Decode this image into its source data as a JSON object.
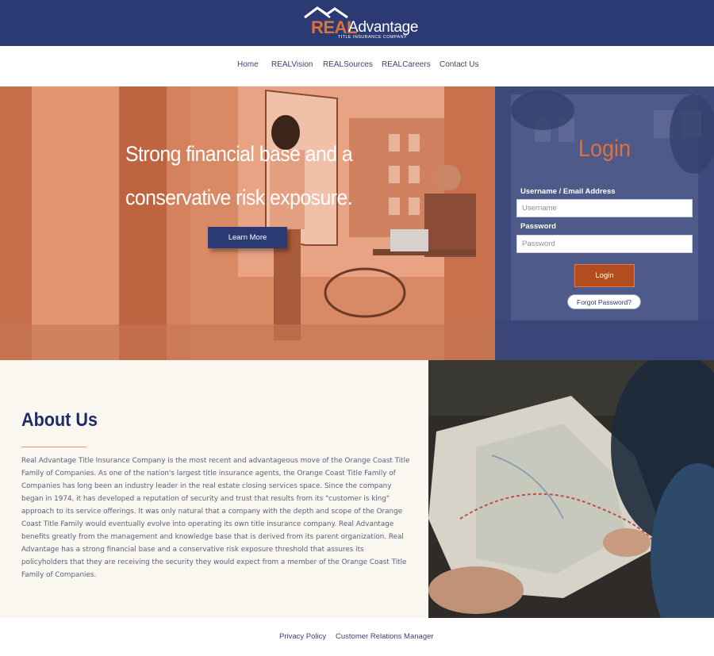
{
  "brand": {
    "real": "REAL",
    "advantage": "Advantage",
    "tagline": "TITLE INSURANCE COMPANY"
  },
  "nav": {
    "items": [
      {
        "label": "Home"
      },
      {
        "label": "REALVision"
      },
      {
        "label": "REALSources"
      },
      {
        "label": "REALCareers"
      },
      {
        "label": "Contact Us"
      }
    ]
  },
  "hero": {
    "headline_line1": "Strong financial base and a",
    "headline_line2": "conservative risk exposure.",
    "cta_label": "Learn More"
  },
  "login": {
    "title": "Login",
    "username_label": "Username / Email Address",
    "username_placeholder": "Username",
    "password_label": "Password",
    "password_placeholder": "Password",
    "submit_label": "Login",
    "forgot_label": "Forgot Password?"
  },
  "about": {
    "title": "About Us",
    "body": "Real Advantage Title Insurance Company is the most recent and advantageous move of the Orange Coast Title Family of Companies. As one of the nation's largest title insurance agents, the Orange Coast Title Family of Companies has long been an industry leader in the real estate closing services space. Since the company began in 1974, it has developed a reputation of security and trust that results from its \"customer is king\" approach to its service offerings. It was only natural that a company with the depth and scope of the Orange Coast Title Family would eventually evolve into operating its own title insurance company. Real Advantage benefits greatly from the management and knowledge base that is derived from its parent organization. Real Advantage has a strong financial base and a conservative risk exposure threshold that assures its policyholders that they are receiving the security they would expect from a member of the Orange Coast Title Family of Companies."
  },
  "footer": {
    "links": [
      {
        "label": "Privacy Policy"
      },
      {
        "label": "Customer Relations Manager"
      }
    ]
  },
  "colors": {
    "navy": "#2c3a74",
    "orange": "#e0703a",
    "hero_overlay": "#d98963",
    "login_bg": "#3d4a7e",
    "login_button": "#b34c1f",
    "about_bg": "#faf7f1"
  },
  "icons": {
    "logo_roof": "house-roof-icon"
  }
}
